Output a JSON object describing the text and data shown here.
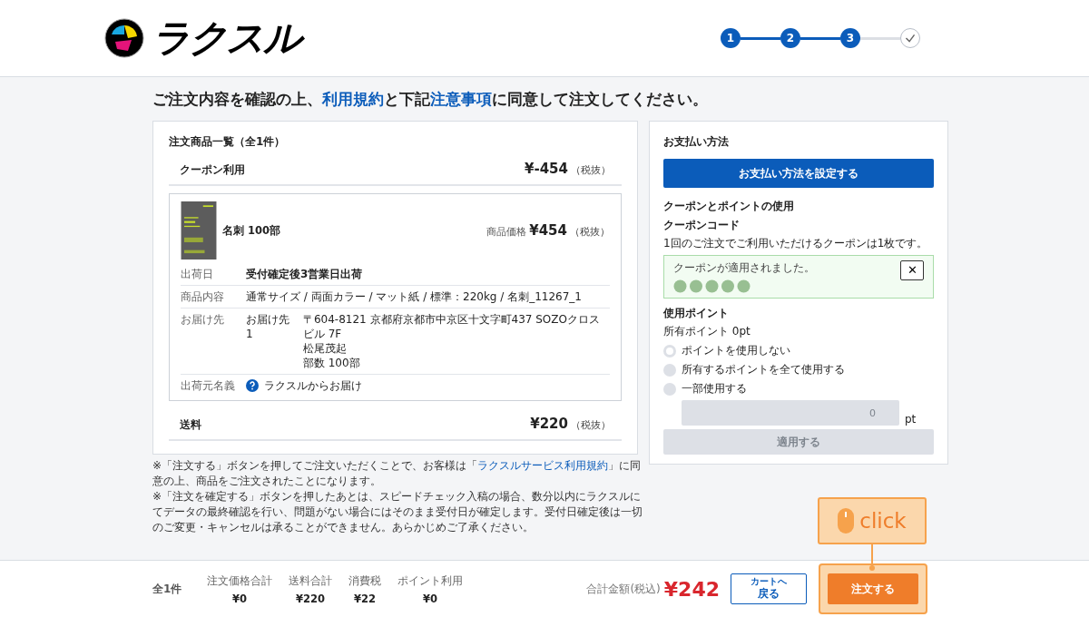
{
  "header": {
    "logo": "ラクスル",
    "steps": [
      {
        "kind": "number",
        "label": "1",
        "done": true
      },
      {
        "kind": "number",
        "label": "2",
        "done": true
      },
      {
        "kind": "number",
        "label": "3",
        "done": true
      },
      {
        "kind": "check",
        "done": false
      }
    ]
  },
  "heading": [
    {
      "kind": "text",
      "text": "ご注文内容を確認の上、"
    },
    {
      "kind": "link",
      "text": "利用規約"
    },
    {
      "kind": "text",
      "text": "と下記"
    },
    {
      "kind": "link",
      "text": "注意事項"
    },
    {
      "kind": "text",
      "text": "に同意して注文してください。"
    }
  ],
  "order_list": {
    "title": "注文商品一覧（全1件）",
    "coupon_row": {
      "label": "クーポン利用",
      "amount": "¥-454",
      "tax": "（税抜）"
    },
    "product": {
      "name": "名刺 100部",
      "price_label": "商品価格",
      "price": "¥454",
      "tax": "（税抜）",
      "details": [
        {
          "kind": "strong",
          "label": "出荷日",
          "value": "受付確定後3営業日出荷"
        },
        {
          "kind": "plain",
          "label": "商品内容",
          "value": "通常サイズ / 両面カラー / マット紙 / 標準：220kg / 名刺_11267_1"
        },
        {
          "kind": "address",
          "label": "お届け先",
          "name": "お届け先1",
          "lines": [
            "〒604-8121 京都府京都市中京区十文字町437 SOZOクロスビル 7F",
            "松尾茂起",
            "部数 100部"
          ]
        },
        {
          "kind": "help",
          "label": "出荷元名義",
          "value": "ラクスルからお届け"
        }
      ]
    },
    "shipping_row": {
      "label": "送料",
      "amount": "¥220",
      "tax": "（税抜）"
    }
  },
  "notes": [
    [
      {
        "kind": "text",
        "text": "※「注文する」ボタンを押してご注文いただくことで、お客様は「"
      },
      {
        "kind": "link",
        "text": "ラクスルサービス利用規約"
      },
      {
        "kind": "text",
        "text": "」に同意の上、商品をご注文されたことになります。"
      }
    ],
    [
      {
        "kind": "text",
        "text": "※「注文を確定する」ボタンを押したあとは、スピードチェック入稿の場合、数分以内にラクスルにてデータの最終確認を行い、問題がない場合にはそのまま受付日が確定します。受付日確定後は一切のご変更・キャンセルは承ることができません。あらかじめご了承ください。"
      }
    ]
  ],
  "payment": {
    "title": "お支払い方法",
    "button": "お支払い方法を設定する",
    "coupon_section": "クーポンとポイントの使用",
    "coupon_code_label": "クーポンコード",
    "coupon_note": "1回のご注文でご利用いただけるクーポンは1枚です。",
    "coupon_applied": {
      "message": "クーポンが適用されました。",
      "close": "✕"
    },
    "points_label": "使用ポイント",
    "points_owned": "所有ポイント 0pt",
    "options": [
      {
        "label": "ポイントを使用しない",
        "disabled": false
      },
      {
        "label": "所有するポイントを全て使用する",
        "disabled": true
      },
      {
        "label": "一部使用する",
        "disabled": true
      }
    ],
    "points_input": {
      "placeholder": "0",
      "unit": "pt",
      "disabled": true
    },
    "apply_button": {
      "label": "適用する",
      "disabled": true
    }
  },
  "footer": {
    "count": "全1件",
    "summary": [
      {
        "label": "注文価格合計",
        "value": "¥0"
      },
      {
        "label": "送料合計",
        "value": "¥220"
      },
      {
        "label": "消費税",
        "value": "¥22"
      },
      {
        "label": "ポイント利用",
        "value": "¥0"
      }
    ],
    "total_label": "合計金額(税込)",
    "total": "¥242",
    "back_small": "カートへ",
    "back": "戻る",
    "order": "注文する"
  },
  "callout": {
    "label": "click"
  }
}
